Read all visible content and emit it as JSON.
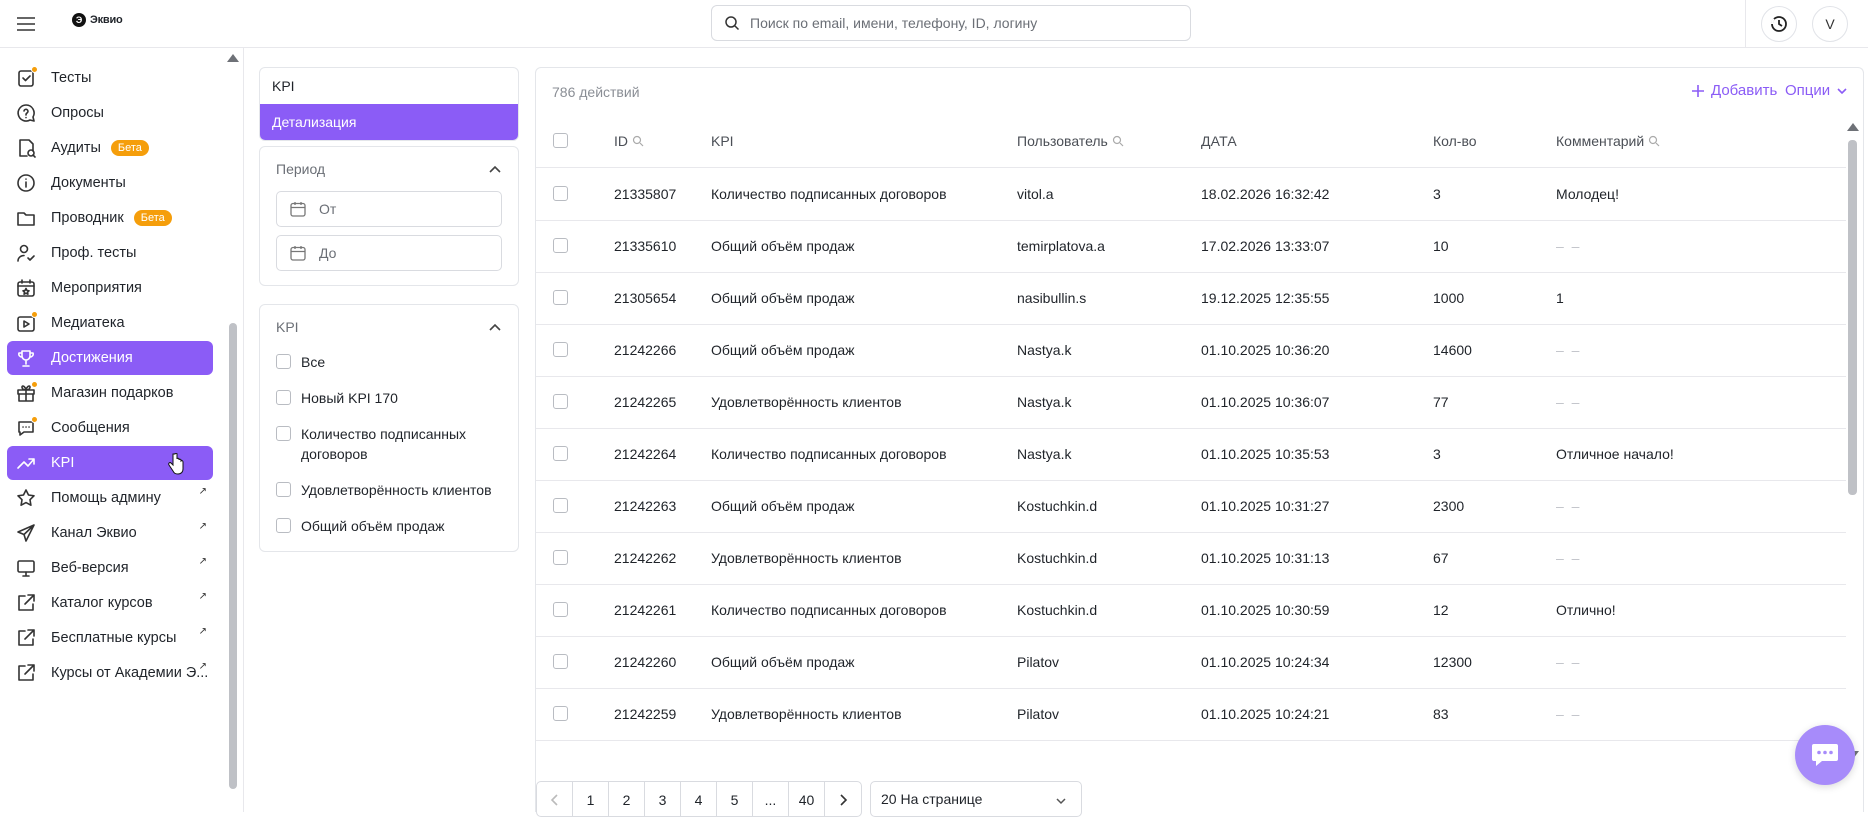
{
  "header": {
    "brand": "Эквио",
    "search_placeholder": "Поиск по email, имени, телефону, ID, логину",
    "avatar_letter": "V"
  },
  "sidebar": {
    "items": [
      {
        "label": "Тесты",
        "icon": "test-check-icon",
        "dot": true
      },
      {
        "label": "Опросы",
        "icon": "question-bubble-icon"
      },
      {
        "label": "Аудиты",
        "icon": "audit-doc-icon",
        "badge": "Бета"
      },
      {
        "label": "Документы",
        "icon": "info-circle-icon"
      },
      {
        "label": "Проводник",
        "icon": "folder-icon",
        "badge": "Бета"
      },
      {
        "label": "Проф. тесты",
        "icon": "user-check-icon"
      },
      {
        "label": "Мероприятия",
        "icon": "calendar-star-icon"
      },
      {
        "label": "Медиатека",
        "icon": "media-play-icon",
        "dot": true
      },
      {
        "label": "Достижения",
        "icon": "trophy-icon",
        "active": true
      },
      {
        "label": "Магазин подарков",
        "icon": "gift-icon",
        "dot": true
      },
      {
        "label": "Сообщения",
        "icon": "chat-bubble-icon",
        "dot": true
      },
      {
        "label": "KPI",
        "icon": "trend-up-icon",
        "active": true
      },
      {
        "label": "Помощь админу",
        "icon": "star-icon",
        "external": true
      },
      {
        "label": "Канал Эквио",
        "icon": "send-icon",
        "external": true
      },
      {
        "label": "Веб-версия",
        "icon": "monitor-icon",
        "external": true
      },
      {
        "label": "Каталог курсов",
        "icon": "external-link-icon",
        "external": true
      },
      {
        "label": "Бесплатные курсы",
        "icon": "external-link-icon",
        "external": true
      },
      {
        "label": "Курсы от Академии Э...",
        "icon": "external-link-icon",
        "external": true
      }
    ],
    "external_glyph": "↗"
  },
  "filters": {
    "tabs": [
      "KPI",
      "Детализация"
    ],
    "period": {
      "title": "Период",
      "from_placeholder": "От",
      "to_placeholder": "До"
    },
    "kpi": {
      "title": "KPI",
      "options": [
        "Все",
        "Новый KPI 170",
        "Количество подписанных договоров",
        "Удовлетворённость клиентов",
        "Общий объём продаж"
      ]
    }
  },
  "table": {
    "count_label": "786 действий",
    "add_label": "Добавить",
    "options_label": "Опции",
    "columns": [
      "ID",
      "KPI",
      "Пользователь",
      "ДАТА",
      "Кол-во",
      "Комментарий"
    ],
    "rows": [
      {
        "id": "21335807",
        "kpi": "Количество подписанных договоров",
        "user": "vitol.a",
        "date": "18.02.2026 16:32:42",
        "qty": "3",
        "comment": "Молодец!"
      },
      {
        "id": "21335610",
        "kpi": "Общий объём продаж",
        "user": "temirplatova.a",
        "date": "17.02.2026 13:33:07",
        "qty": "10",
        "comment": "– –"
      },
      {
        "id": "21305654",
        "kpi": "Общий объём продаж",
        "user": "nasibullin.s",
        "date": "19.12.2025 12:35:55",
        "qty": "1000",
        "comment": "1"
      },
      {
        "id": "21242266",
        "kpi": "Общий объём продаж",
        "user": "Nastya.k",
        "date": "01.10.2025 10:36:20",
        "qty": "14600",
        "comment": "– –"
      },
      {
        "id": "21242265",
        "kpi": "Удовлетворённость клиентов",
        "user": "Nastya.k",
        "date": "01.10.2025 10:36:07",
        "qty": "77",
        "comment": "– –"
      },
      {
        "id": "21242264",
        "kpi": "Количество подписанных договоров",
        "user": "Nastya.k",
        "date": "01.10.2025 10:35:53",
        "qty": "3",
        "comment": "Отличное начало!"
      },
      {
        "id": "21242263",
        "kpi": "Общий объём продаж",
        "user": "Kostuchkin.d",
        "date": "01.10.2025 10:31:27",
        "qty": "2300",
        "comment": "– –"
      },
      {
        "id": "21242262",
        "kpi": "Удовлетворённость клиентов",
        "user": "Kostuchkin.d",
        "date": "01.10.2025 10:31:13",
        "qty": "67",
        "comment": "– –"
      },
      {
        "id": "21242261",
        "kpi": "Количество подписанных договоров",
        "user": "Kostuchkin.d",
        "date": "01.10.2025 10:30:59",
        "qty": "12",
        "comment": "Отлично!"
      },
      {
        "id": "21242260",
        "kpi": "Общий объём продаж",
        "user": "Pilatov",
        "date": "01.10.2025 10:24:34",
        "qty": "12300",
        "comment": "– –"
      },
      {
        "id": "21242259",
        "kpi": "Удовлетворённость клиентов",
        "user": "Pilatov",
        "date": "01.10.2025 10:24:21",
        "qty": "83",
        "comment": "– –"
      }
    ]
  },
  "pagination": {
    "pages": [
      "1",
      "2",
      "3",
      "4",
      "5",
      "...",
      "40"
    ],
    "per_page": "20 На странице"
  },
  "colors": {
    "accent": "#8b5cf6",
    "badge": "#f59e0b",
    "fab": "#a78bfa"
  }
}
